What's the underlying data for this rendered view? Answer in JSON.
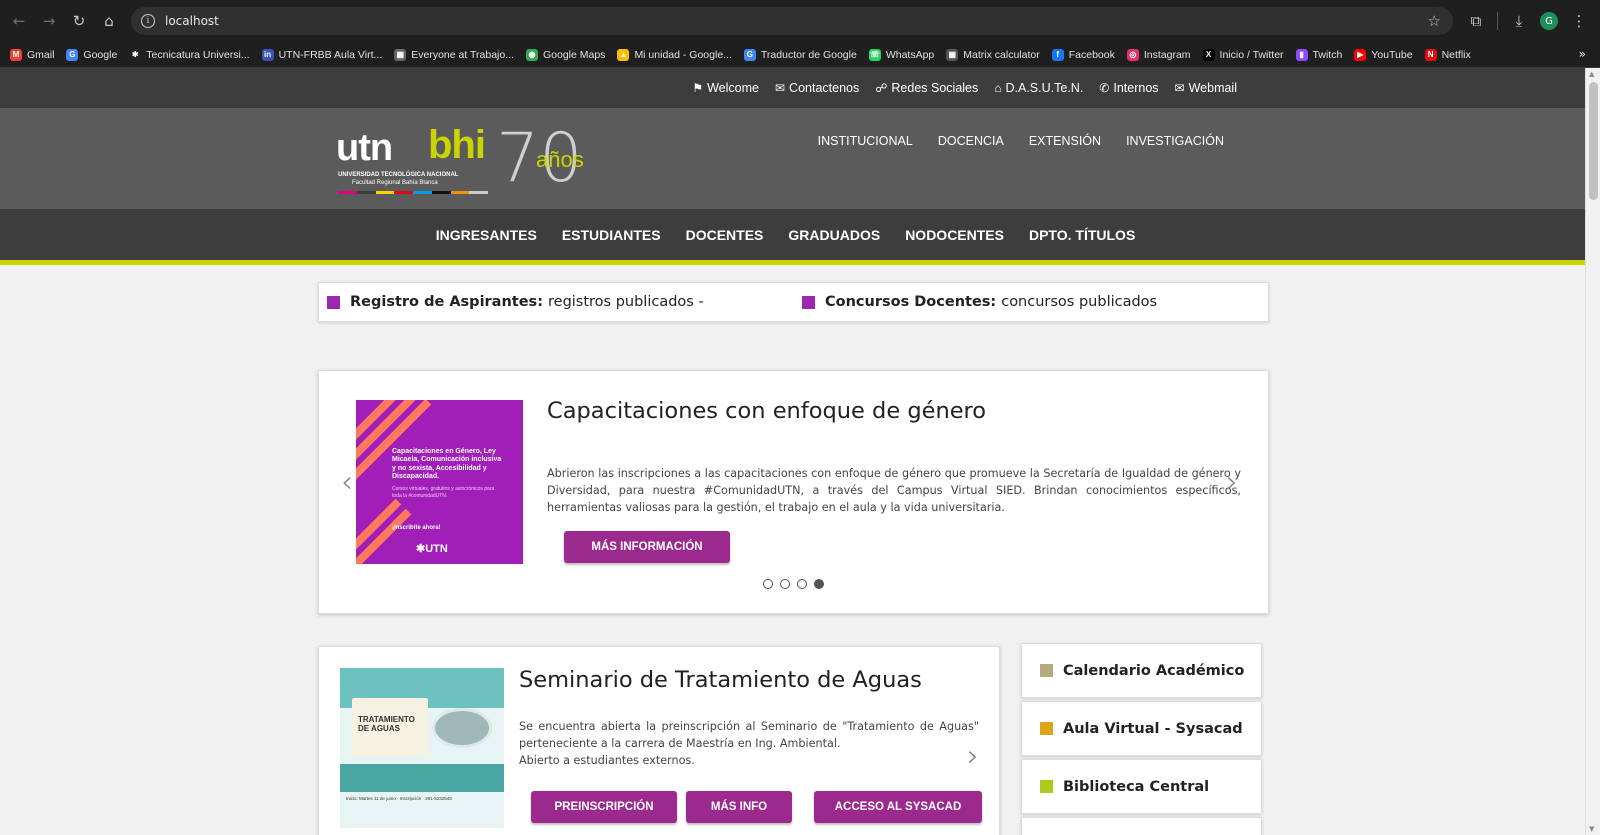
{
  "browser": {
    "url": "localhost",
    "profile_initial": "G",
    "bookmarks": [
      {
        "label": "Gmail",
        "color": "#ea4335",
        "glyph": "M"
      },
      {
        "label": "Google",
        "color": "#4285f4",
        "glyph": "G"
      },
      {
        "label": "Tecnicatura Universi...",
        "color": "#222222",
        "glyph": "✱"
      },
      {
        "label": "UTN-FRBB Aula Virt...",
        "color": "#3f51b5",
        "glyph": "in"
      },
      {
        "label": "Everyone at Trabajo...",
        "color": "#666666",
        "glyph": "▦"
      },
      {
        "label": "Google Maps",
        "color": "#34a853",
        "glyph": "◉"
      },
      {
        "label": "Mi unidad - Google...",
        "color": "#fbbc05",
        "glyph": "▲"
      },
      {
        "label": "Traductor de Google",
        "color": "#4285f4",
        "glyph": "G"
      },
      {
        "label": "WhatsApp",
        "color": "#25d366",
        "glyph": "☏"
      },
      {
        "label": "Matrix calculator",
        "color": "#555555",
        "glyph": "▦"
      },
      {
        "label": "Facebook",
        "color": "#1877f2",
        "glyph": "f"
      },
      {
        "label": "Instagram",
        "color": "#e1306c",
        "glyph": "◎"
      },
      {
        "label": "Inicio / Twitter",
        "color": "#000000",
        "glyph": "X"
      },
      {
        "label": "Twitch",
        "color": "#9146ff",
        "glyph": "▮"
      },
      {
        "label": "YouTube",
        "color": "#ff0000",
        "glyph": "▶"
      },
      {
        "label": "Netflix",
        "color": "#e50914",
        "glyph": "N"
      }
    ],
    "more": "»"
  },
  "topbar": {
    "links": [
      {
        "icon": "⚑",
        "label": "Welcome"
      },
      {
        "icon": "✉",
        "label": "Contactenos"
      },
      {
        "icon": "☍",
        "label": "Redes Sociales"
      },
      {
        "icon": "⌂",
        "label": "D.A.S.U.Te.N."
      },
      {
        "icon": "✆",
        "label": "Internos"
      },
      {
        "icon": "✉",
        "label": "Webmail"
      }
    ]
  },
  "logo": {
    "utn": "utn",
    "bhi": "bhi",
    "line1": "UNIVERSIDAD TECNOLÓGICA NACIONAL",
    "line2": "Facultad Regional Bahía Blanca",
    "seventy": "70",
    "anos": "años"
  },
  "nav_primary": [
    "INSTITUCIONAL",
    "DOCENCIA",
    "EXTENSIÓN",
    "INVESTIGACIÓN"
  ],
  "nav_secondary": [
    "INGRESANTES",
    "ESTUDIANTES",
    "DOCENTES",
    "GRADUADOS",
    "NODOCENTES",
    "DPTO. TÍTULOS"
  ],
  "ticker": [
    {
      "bold": "Registro de Aspirantes:",
      "text": "registros publicados -"
    },
    {
      "bold": "Concursos Docentes:",
      "text": "concursos publicados"
    }
  ],
  "slider": {
    "image_text": {
      "title": "Capacitaciones en Género, Ley Micaela, Comunicación inclusiva y no sexista, Accesibilidad y Discapacidad.",
      "sub": "Cursos virtuales, gratuitos y asincrónicos para toda la #comunidadUTN.",
      "cta": "¡Inscribite ahora!",
      "brand": "✱UTN"
    },
    "title": "Capacitaciones con enfoque de género",
    "text": "Abrieron las inscripciones a las capacitaciones con enfoque de género que promueve la Secretaría de Igualdad de género y Diversidad, para nuestra #ComunidadUTN, a través del Campus Virtual SIED. Brindan conocimientos específicos, herramientas valiosas para la gestión, el trabajo en el aula y la vida universitaria.",
    "button": "MÁS INFORMACIÓN",
    "prev": "‹",
    "next": "›",
    "slide_count": 4,
    "active_slide": 4,
    "accent": "#9c2a8e"
  },
  "seminario": {
    "image_text": {
      "title": "TRATAMIENTO DE AGUAS",
      "footer": "Inicio: Martes 11 de junio · Inscripción · 291-5232549"
    },
    "title": "Seminario de Tratamiento de Aguas",
    "text": "Se encuentra abierta la preinscripción al Seminario de \"Tratamiento de Aguas\" perteneciente a la carrera de Maestría en Ing. Ambiental.",
    "text2": "Abierto a estudiantes externos.",
    "buttons": [
      "PREINSCRIPCIÓN",
      "MÁS INFO",
      "ACCESO AL SYSACAD"
    ],
    "next": "›"
  },
  "sidebar": [
    {
      "label": "Calendario Académico",
      "color": "#b5aa7c"
    },
    {
      "label": "Aula Virtual - Sysacad",
      "color": "#e0a41c"
    },
    {
      "label": "Biblioteca Central",
      "color": "#a9cc1c"
    }
  ]
}
